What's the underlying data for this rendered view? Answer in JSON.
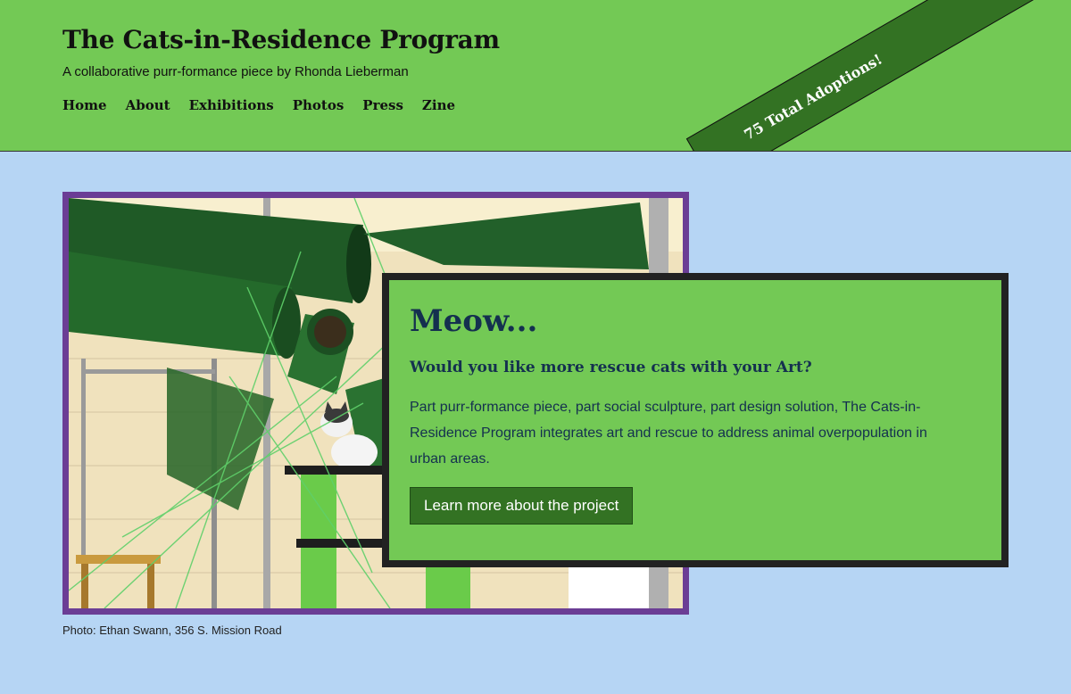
{
  "header": {
    "title": "The Cats-in-Residence Program",
    "tagline": "A collaborative purr-formance piece by Rhonda Lieberman",
    "nav": [
      "Home",
      "About",
      "Exhibitions",
      "Photos",
      "Press",
      "Zine"
    ]
  },
  "ribbon": {
    "text": "75 Total Adoptions!"
  },
  "hero": {
    "credit": "Photo: Ethan Swann, 356 S. Mission Road"
  },
  "promo": {
    "heading": "Meow...",
    "subheading": "Would you like more rescue cats with your Art?",
    "body": "Part purr-formance piece, part social sculpture, part design solution, The Cats-in-Residence Program integrates art and rescue to address animal overpopulation in urban areas.",
    "button_label": "Learn more about the project"
  },
  "colors": {
    "header_bg": "#73c955",
    "page_bg": "#b6d5f4",
    "ribbon_bg": "#337223",
    "frame": "#6b3d95",
    "heading_text": "#14304f"
  }
}
